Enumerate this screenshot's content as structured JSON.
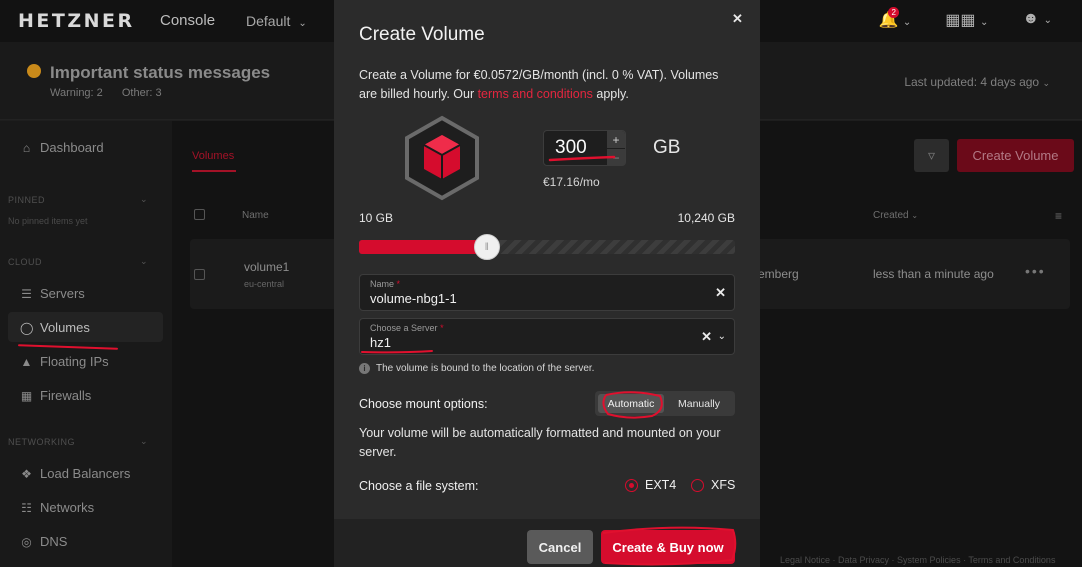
{
  "header": {
    "logo": "HETZNER",
    "console": "Console",
    "project": "Default",
    "notification_count": "2",
    "icons": [
      "bell-icon",
      "grid-icon",
      "user-icon"
    ]
  },
  "status": {
    "title": "Important status messages",
    "warning": "Warning: 2",
    "other": "Other: 3",
    "last_updated": "Last updated: 4 days ago"
  },
  "sidebar": {
    "dashboard": "Dashboard",
    "pinned_label": "PINNED",
    "pinned_empty": "No pinned items yet",
    "cloud_label": "CLOUD",
    "servers": "Servers",
    "volumes": "Volumes",
    "floating_ips": "Floating IPs",
    "firewalls": "Firewalls",
    "networking_label": "NETWORKING",
    "load_balancers": "Load Balancers",
    "networks": "Networks",
    "dns": "DNS"
  },
  "main": {
    "tab": "Volumes",
    "create_button": "Create Volume",
    "columns": {
      "name": "Name",
      "created": "Created"
    },
    "row": {
      "name": "volume1",
      "location": "eu-central",
      "server_partial": "emberg",
      "created": "less than a minute ago"
    },
    "footer": "Legal Notice · Data Privacy · System Policies · Terms and Conditions"
  },
  "modal": {
    "title": "Create Volume",
    "desc_text": "Create a Volume for €0.0572/GB/month (incl. 0 % VAT). Volumes are billed hourly. Our ",
    "desc_link": "terms and conditions",
    "desc_end": " apply.",
    "size_value": "300",
    "size_unit": "GB",
    "price_monthly": "€17.16/mo",
    "slider_min": "10 GB",
    "slider_max": "10,240 GB",
    "slider_fraction": 0.34,
    "name_label": "Name",
    "name_value": "volume-nbg1-1",
    "server_label": "Choose a Server",
    "server_value": "hz1",
    "info": "The volume is bound to the location of the server.",
    "mount_label": "Choose mount options:",
    "mount_automatic": "Automatic",
    "mount_manually": "Manually",
    "mount_desc": "Your volume will be automatically formatted and mounted on your server.",
    "fs_label": "Choose a file system:",
    "fs_ext4": "EXT4",
    "fs_xfs": "XFS",
    "cancel": "Cancel",
    "create_buy": "Create & Buy now"
  },
  "colors": {
    "accent": "#d50c2d",
    "modal_bg": "#2b2b2b",
    "annotation": "#e0102e"
  }
}
